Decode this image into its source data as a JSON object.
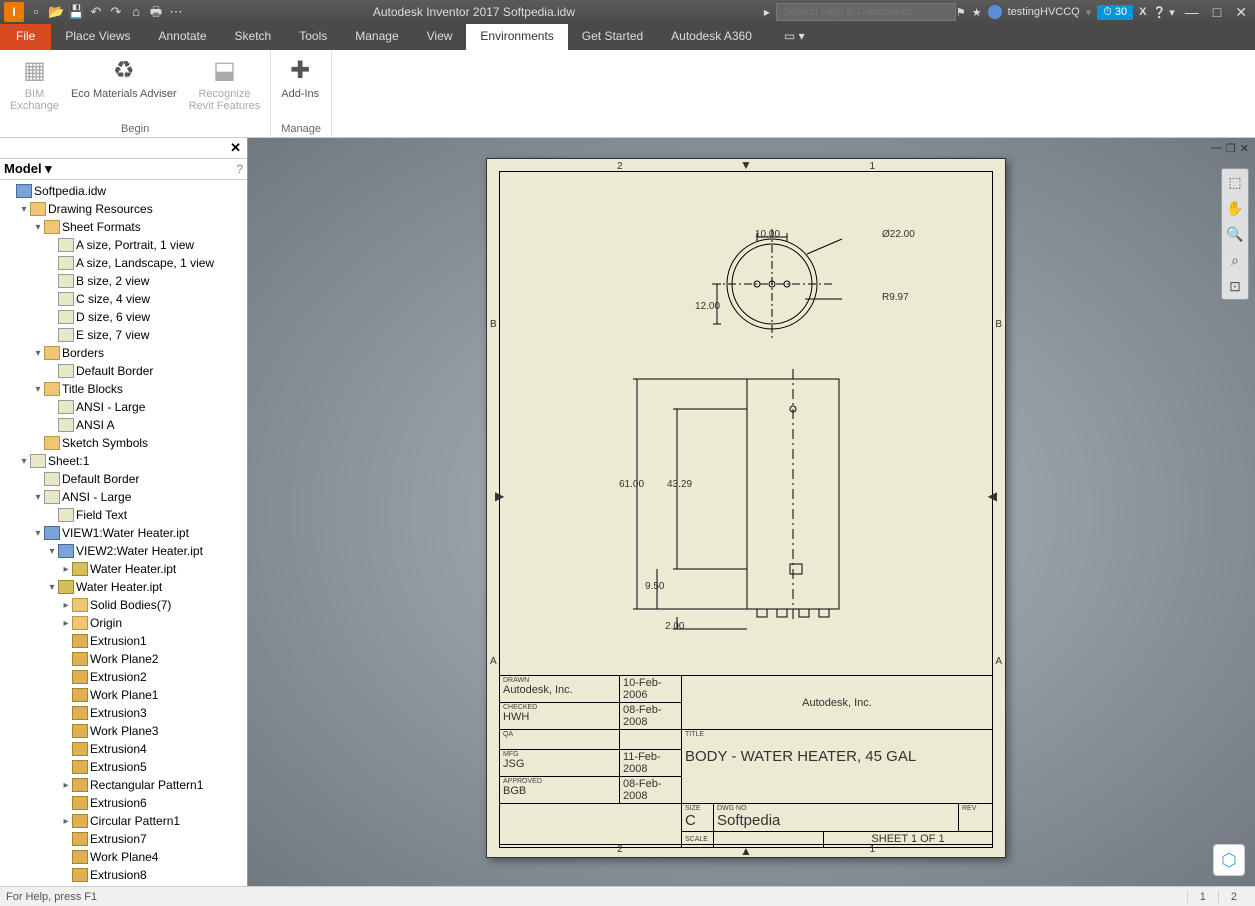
{
  "app": {
    "title": "Autodesk Inventor 2017    Softpedia.idw"
  },
  "search": {
    "placeholder": "Search Help & Commands..."
  },
  "user": {
    "name": "testingHVCCQ",
    "badge": "30"
  },
  "menubar": {
    "file": "File",
    "items": [
      "Place Views",
      "Annotate",
      "Sketch",
      "Tools",
      "Manage",
      "View",
      "Environments",
      "Get Started",
      "Autodesk A360"
    ],
    "active": "Environments"
  },
  "ribbon": {
    "groups": [
      {
        "label": "Begin",
        "buttons": [
          {
            "label": "BIM\nExchange",
            "disabled": true
          },
          {
            "label": "Eco Materials Adviser",
            "disabled": false
          },
          {
            "label": "Recognize\nRevit Features",
            "disabled": true
          }
        ]
      },
      {
        "label": "Manage",
        "buttons": [
          {
            "label": "Add-Ins",
            "disabled": false
          }
        ]
      }
    ]
  },
  "browser": {
    "title": "Model",
    "tree": [
      {
        "d": 0,
        "e": "",
        "i": "view",
        "t": "Softpedia.idw"
      },
      {
        "d": 1,
        "e": "▾",
        "i": "folder",
        "t": "Drawing Resources"
      },
      {
        "d": 2,
        "e": "▾",
        "i": "folder",
        "t": "Sheet Formats"
      },
      {
        "d": 3,
        "e": "",
        "i": "sheet",
        "t": "A size, Portrait, 1 view"
      },
      {
        "d": 3,
        "e": "",
        "i": "sheet",
        "t": "A size, Landscape, 1 view"
      },
      {
        "d": 3,
        "e": "",
        "i": "sheet",
        "t": "B size, 2 view"
      },
      {
        "d": 3,
        "e": "",
        "i": "sheet",
        "t": "C size, 4 view"
      },
      {
        "d": 3,
        "e": "",
        "i": "sheet",
        "t": "D size, 6 view"
      },
      {
        "d": 3,
        "e": "",
        "i": "sheet",
        "t": "E size, 7 view"
      },
      {
        "d": 2,
        "e": "▾",
        "i": "folder",
        "t": "Borders"
      },
      {
        "d": 3,
        "e": "",
        "i": "sheet",
        "t": "Default Border"
      },
      {
        "d": 2,
        "e": "▾",
        "i": "folder",
        "t": "Title Blocks"
      },
      {
        "d": 3,
        "e": "",
        "i": "sheet",
        "t": "ANSI - Large"
      },
      {
        "d": 3,
        "e": "",
        "i": "sheet",
        "t": "ANSI A"
      },
      {
        "d": 2,
        "e": "",
        "i": "folder",
        "t": "Sketch Symbols"
      },
      {
        "d": 1,
        "e": "▾",
        "i": "sheet",
        "t": "Sheet:1"
      },
      {
        "d": 2,
        "e": "",
        "i": "sheet",
        "t": "Default Border"
      },
      {
        "d": 2,
        "e": "▾",
        "i": "sheet",
        "t": "ANSI - Large"
      },
      {
        "d": 3,
        "e": "",
        "i": "sheet",
        "t": "Field Text"
      },
      {
        "d": 2,
        "e": "▾",
        "i": "view",
        "t": "VIEW1:Water Heater.ipt"
      },
      {
        "d": 3,
        "e": "▾",
        "i": "view",
        "t": "VIEW2:Water Heater.ipt"
      },
      {
        "d": 4,
        "e": "▸",
        "i": "part",
        "t": "Water Heater.ipt"
      },
      {
        "d": 3,
        "e": "▾",
        "i": "part",
        "t": "Water Heater.ipt"
      },
      {
        "d": 4,
        "e": "▸",
        "i": "folder",
        "t": "Solid Bodies(7)"
      },
      {
        "d": 4,
        "e": "▸",
        "i": "folder",
        "t": "Origin"
      },
      {
        "d": 4,
        "e": "",
        "i": "feat",
        "t": "Extrusion1"
      },
      {
        "d": 4,
        "e": "",
        "i": "feat",
        "t": "Work Plane2"
      },
      {
        "d": 4,
        "e": "",
        "i": "feat",
        "t": "Extrusion2"
      },
      {
        "d": 4,
        "e": "",
        "i": "feat",
        "t": "Work Plane1"
      },
      {
        "d": 4,
        "e": "",
        "i": "feat",
        "t": "Extrusion3"
      },
      {
        "d": 4,
        "e": "",
        "i": "feat",
        "t": "Work Plane3"
      },
      {
        "d": 4,
        "e": "",
        "i": "feat",
        "t": "Extrusion4"
      },
      {
        "d": 4,
        "e": "",
        "i": "feat",
        "t": "Extrusion5"
      },
      {
        "d": 4,
        "e": "▸",
        "i": "feat",
        "t": "Rectangular Pattern1"
      },
      {
        "d": 4,
        "e": "",
        "i": "feat",
        "t": "Extrusion6"
      },
      {
        "d": 4,
        "e": "▸",
        "i": "feat",
        "t": "Circular Pattern1"
      },
      {
        "d": 4,
        "e": "",
        "i": "feat",
        "t": "Extrusion7"
      },
      {
        "d": 4,
        "e": "",
        "i": "feat",
        "t": "Work Plane4"
      },
      {
        "d": 4,
        "e": "",
        "i": "feat",
        "t": "Extrusion8"
      }
    ]
  },
  "drawing": {
    "zones": {
      "top": [
        "2",
        "1"
      ],
      "side": [
        "A",
        "B"
      ]
    },
    "dims": {
      "d1": "10.00",
      "d2": "Ø22.00",
      "d3": "R9.97",
      "d4": "12.00",
      "d5": "61.00",
      "d6": "43.29",
      "d7": "9.50",
      "d8": "2.00"
    },
    "titleblock": {
      "drawn_lbl": "DRAWN",
      "drawn_by": "Autodesk, Inc.",
      "drawn_date": "10-Feb-2006",
      "checked_lbl": "CHECKED",
      "checked_by": "HWH",
      "checked_date": "08-Feb-2008",
      "qa_lbl": "QA",
      "mfg_lbl": "MFG",
      "mfg_by": "JSG",
      "mfg_date": "11-Feb-2008",
      "approved_lbl": "APPROVED",
      "approved_by": "BGB",
      "approved_date": "08-Feb-2008",
      "company": "Autodesk, Inc.",
      "title_lbl": "TITLE",
      "title": "BODY - WATER HEATER, 45 GAL",
      "size_lbl": "SIZE",
      "size": "C",
      "dwgno_lbl": "DWG NO",
      "dwgno": "Softpedia",
      "rev_lbl": "REV",
      "scale_lbl": "SCALE",
      "sheet": "SHEET 1  OF 1"
    }
  },
  "status": {
    "help": "For Help, press F1",
    "pages": [
      "1",
      "2"
    ]
  }
}
